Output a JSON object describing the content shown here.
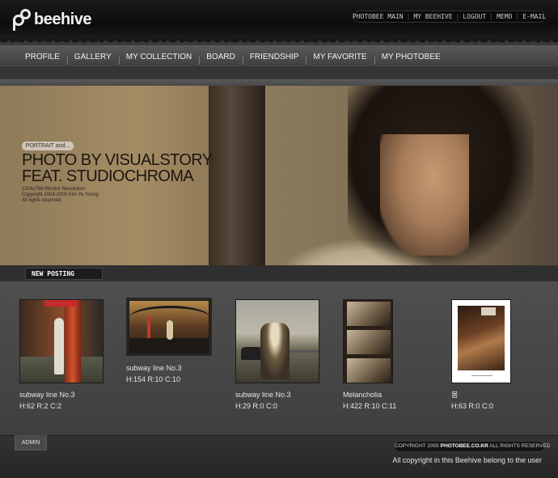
{
  "brand": {
    "name": "beehive"
  },
  "top_nav": [
    "PHOTOBEE MAIN",
    "MY BEEHIVE",
    "LOGOUT",
    "MEMO",
    "E-MAIL"
  ],
  "main_nav": [
    "PROFILE",
    "GALLERY",
    "MY COLLECTION",
    "BOARD",
    "FRIENDSHIP",
    "MY FAVORITE",
    "MY PHOTOBEE"
  ],
  "hero": {
    "badge": "PORTRAIT and...",
    "title_line1": "PHOTO BY VISUALSTORY",
    "title_line2": "FEAT. STUDIOCHROMA",
    "meta": [
      "1024x768 Monitor Resolution",
      "Copyright 2003-2005 Kim Ye Young",
      "All rights reserved."
    ]
  },
  "new_posting": {
    "label": "NEW POSTING",
    "posts": [
      {
        "caption": "subway line No.3",
        "stats": "H:62 R:2 C:2"
      },
      {
        "caption": "subway line No.3",
        "stats": "H:154 R:10 C:10"
      },
      {
        "caption": "subway line No.3",
        "stats": "H:29 R:0 C:0"
      },
      {
        "caption": "Melancholia",
        "stats": "H:422 R:10 C:11"
      },
      {
        "caption": "봄",
        "stats": "H:63 R:0 C:0"
      }
    ]
  },
  "footer": {
    "admin": "ADMIN",
    "copyright_prefix": "COPYRIGHT 2005",
    "copyright_site": "PHOTOBEE.CO.KR",
    "copyright_suffix": "ALL RIGHTS RESERVED",
    "owner_note": "All copyright in this Beehive belong to the user"
  }
}
